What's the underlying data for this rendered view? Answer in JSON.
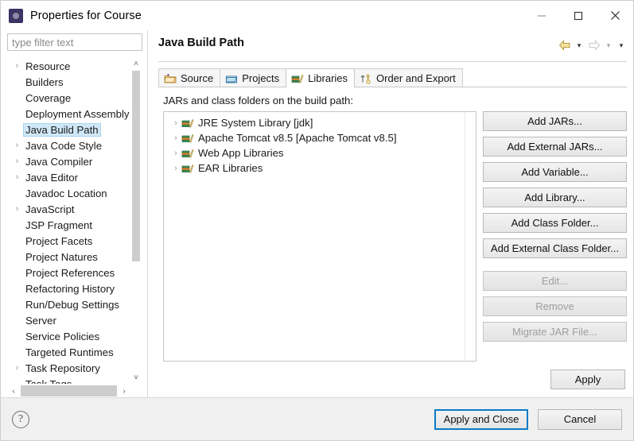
{
  "window": {
    "title": "Properties for Course",
    "icon": "eclipse-properties-icon",
    "controls": {
      "minimize": "minimize-icon",
      "maximize": "maximize-icon",
      "close": "close-icon"
    }
  },
  "sidebar": {
    "filter_placeholder": "type filter text",
    "filter_value": "",
    "selected": "Java Build Path",
    "items": [
      {
        "label": "Resource",
        "expandable": true
      },
      {
        "label": "Builders",
        "expandable": false
      },
      {
        "label": "Coverage",
        "expandable": false
      },
      {
        "label": "Deployment Assembly",
        "expandable": false
      },
      {
        "label": "Java Build Path",
        "expandable": false,
        "selected": true
      },
      {
        "label": "Java Code Style",
        "expandable": true
      },
      {
        "label": "Java Compiler",
        "expandable": true
      },
      {
        "label": "Java Editor",
        "expandable": true
      },
      {
        "label": "Javadoc Location",
        "expandable": false
      },
      {
        "label": "JavaScript",
        "expandable": true
      },
      {
        "label": "JSP Fragment",
        "expandable": false
      },
      {
        "label": "Project Facets",
        "expandable": false
      },
      {
        "label": "Project Natures",
        "expandable": false
      },
      {
        "label": "Project References",
        "expandable": false
      },
      {
        "label": "Refactoring History",
        "expandable": false
      },
      {
        "label": "Run/Debug Settings",
        "expandable": false
      },
      {
        "label": "Server",
        "expandable": false
      },
      {
        "label": "Service Policies",
        "expandable": false
      },
      {
        "label": "Targeted Runtimes",
        "expandable": false
      },
      {
        "label": "Task Repository",
        "expandable": true
      },
      {
        "label": "Task Tags",
        "expandable": false
      }
    ],
    "scroll_up": "˄",
    "scroll_down": "˅",
    "scroll_left": "‹",
    "scroll_right": "›"
  },
  "page": {
    "title": "Java Build Path",
    "nav": {
      "back": "back-arrow-icon",
      "back_menu": "▾",
      "forward": "forward-arrow-icon",
      "forward_menu": "▾",
      "view_menu": "▾"
    },
    "tabs": [
      {
        "label": "Source",
        "icon": "source-folder-icon",
        "active": false
      },
      {
        "label": "Projects",
        "icon": "projects-icon",
        "active": false
      },
      {
        "label": "Libraries",
        "icon": "libraries-icon",
        "active": true
      },
      {
        "label": "Order and Export",
        "icon": "order-export-icon",
        "active": false
      }
    ],
    "pane_label": "JARs and class folders on the build path:",
    "libraries": [
      {
        "label": "JRE System Library [jdk]",
        "icon": "library-icon",
        "expandable": true
      },
      {
        "label": "Apache Tomcat v8.5 [Apache Tomcat v8.5]",
        "icon": "library-icon",
        "expandable": true
      },
      {
        "label": "Web App Libraries",
        "icon": "library-icon",
        "expandable": true
      },
      {
        "label": "EAR Libraries",
        "icon": "library-icon",
        "expandable": true
      }
    ],
    "buttons": [
      {
        "label": "Add JARs...",
        "enabled": true
      },
      {
        "label": "Add External JARs...",
        "enabled": true
      },
      {
        "label": "Add Variable...",
        "enabled": true
      },
      {
        "label": "Add Library...",
        "enabled": true
      },
      {
        "label": "Add Class Folder...",
        "enabled": true
      },
      {
        "label": "Add External Class Folder...",
        "enabled": true
      },
      {
        "label": "Edit...",
        "enabled": false
      },
      {
        "label": "Remove",
        "enabled": false
      },
      {
        "label": "Migrate JAR File...",
        "enabled": false
      }
    ],
    "apply_label": "Apply"
  },
  "footer": {
    "help": "?",
    "help_icon": "help-icon",
    "apply_and_close": "Apply and Close",
    "cancel": "Cancel"
  },
  "colors": {
    "selection": "#cfe8f7",
    "default_button_border": "#0a7bc4",
    "tab_active_bg": "#ffffff",
    "dialog_bg": "#f0f0f0"
  },
  "tree_arrow": "›"
}
